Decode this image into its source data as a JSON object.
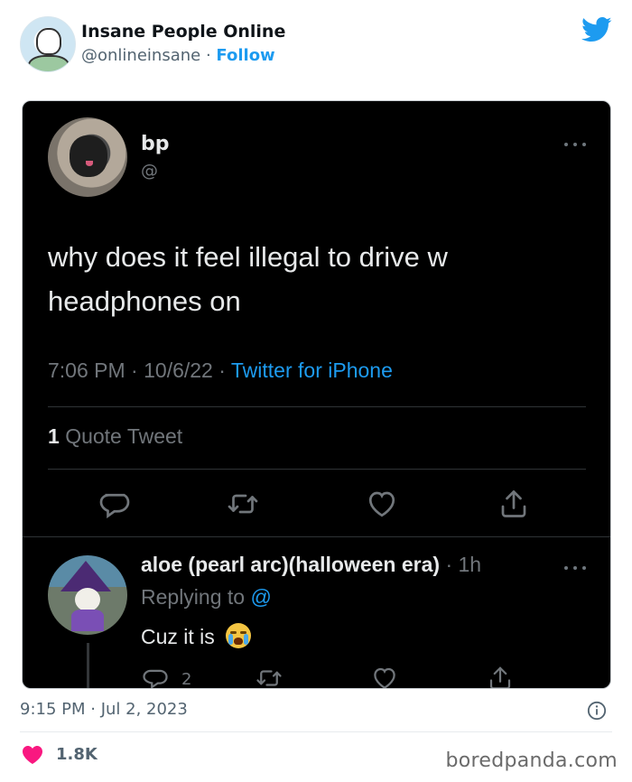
{
  "embed": {
    "display_name": "Insane People Online",
    "handle": "@onlineinsane",
    "separator": "·",
    "follow_label": "Follow"
  },
  "screenshot": {
    "tweet": {
      "author_name": "bp",
      "author_handle": "@",
      "text": "why does it feel illegal to drive w headphones on",
      "time": "7:06 PM",
      "date": "10/6/22",
      "source": "Twitter for iPhone",
      "meta_separator": "·",
      "quote_count": "1",
      "quote_label": "Quote Tweet"
    },
    "reply": {
      "author_name": "aloe (pearl arc)(halloween era)",
      "time_ago": "· 1h",
      "replying_to_label": "Replying to",
      "replying_to_handle": "@",
      "text": "Cuz it is",
      "emoji": "loudly-crying-face",
      "reply_count": "2"
    }
  },
  "footer": {
    "timestamp": "9:15 PM · Jul 2, 2023",
    "likes": "1.8K",
    "watermark": "boredpanda.com"
  },
  "colors": {
    "twitter_blue": "#1d9bf0",
    "heart_pink": "#f91880",
    "card_background": "#000000"
  },
  "icons": [
    "twitter-bird-icon",
    "more-icon",
    "reply-icon",
    "retweet-icon",
    "like-icon",
    "share-icon",
    "info-icon",
    "heart-icon"
  ]
}
